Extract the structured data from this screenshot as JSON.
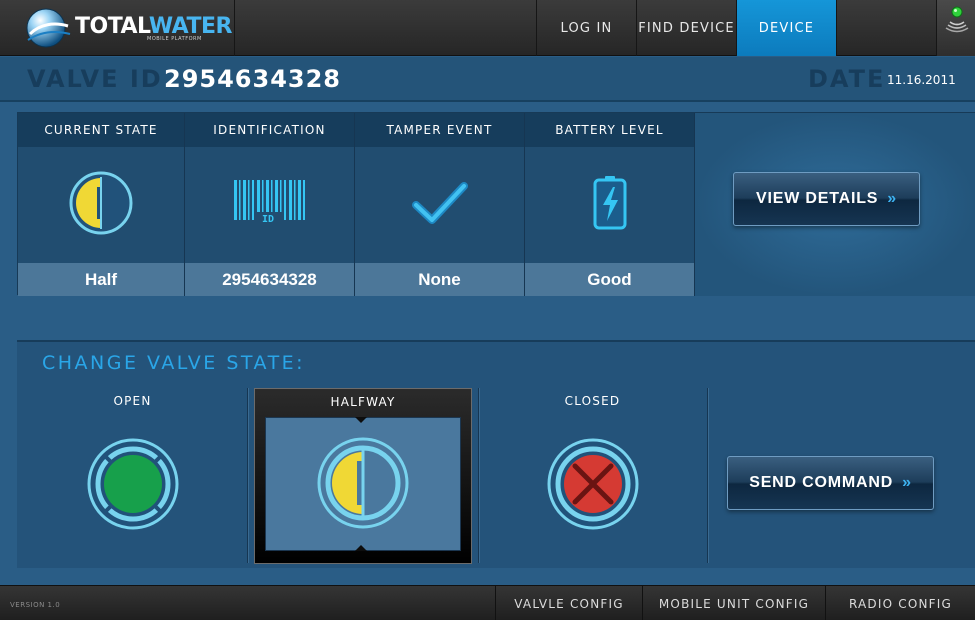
{
  "brand": {
    "name_part1": "TOTAL",
    "name_part2": "WATER",
    "tagline": "MOBILE PLATFORM"
  },
  "nav": {
    "items": [
      {
        "label": "LOG IN",
        "active": false
      },
      {
        "label": "FIND DEVICE",
        "active": false
      },
      {
        "label": "DEVICE",
        "active": true
      }
    ],
    "signal_icon": "signal-status-icon"
  },
  "valve": {
    "id_label": "VALVE ID",
    "id_value": "2954634328",
    "date_label": "DATE",
    "date_value": "11.16.2011"
  },
  "status": {
    "columns": [
      {
        "header": "CURRENT STATE",
        "icon": "half-valve-icon",
        "value": "Half"
      },
      {
        "header": "IDENTIFICATION",
        "icon": "barcode-id-icon",
        "value": "2954634328"
      },
      {
        "header": "TAMPER EVENT",
        "icon": "checkmark-icon",
        "value": "None"
      },
      {
        "header": "BATTERY LEVEL",
        "icon": "battery-icon",
        "value": "Good"
      }
    ],
    "details_button": "VIEW DETAILS"
  },
  "change_state": {
    "title": "CHANGE VALVE STATE:",
    "options": [
      {
        "label": "OPEN",
        "icon": "open-valve-icon",
        "selected": false
      },
      {
        "label": "HALFWAY",
        "icon": "half-valve-icon",
        "selected": true
      },
      {
        "label": "CLOSED",
        "icon": "closed-valve-icon",
        "selected": false
      }
    ],
    "send_button": "SEND COMMAND"
  },
  "footer": {
    "version": "VERSION 1.0",
    "items": [
      {
        "label": "VALVLE CONFIG"
      },
      {
        "label": "MOBILE UNIT CONFIG"
      },
      {
        "label": "RADIO CONFIG"
      }
    ]
  },
  "colors": {
    "accent_blue": "#1596d8",
    "ring_blue": "#78d3ee",
    "half_yellow": "#f0d835",
    "open_green": "#17a04b",
    "closed_red": "#d53a33"
  }
}
